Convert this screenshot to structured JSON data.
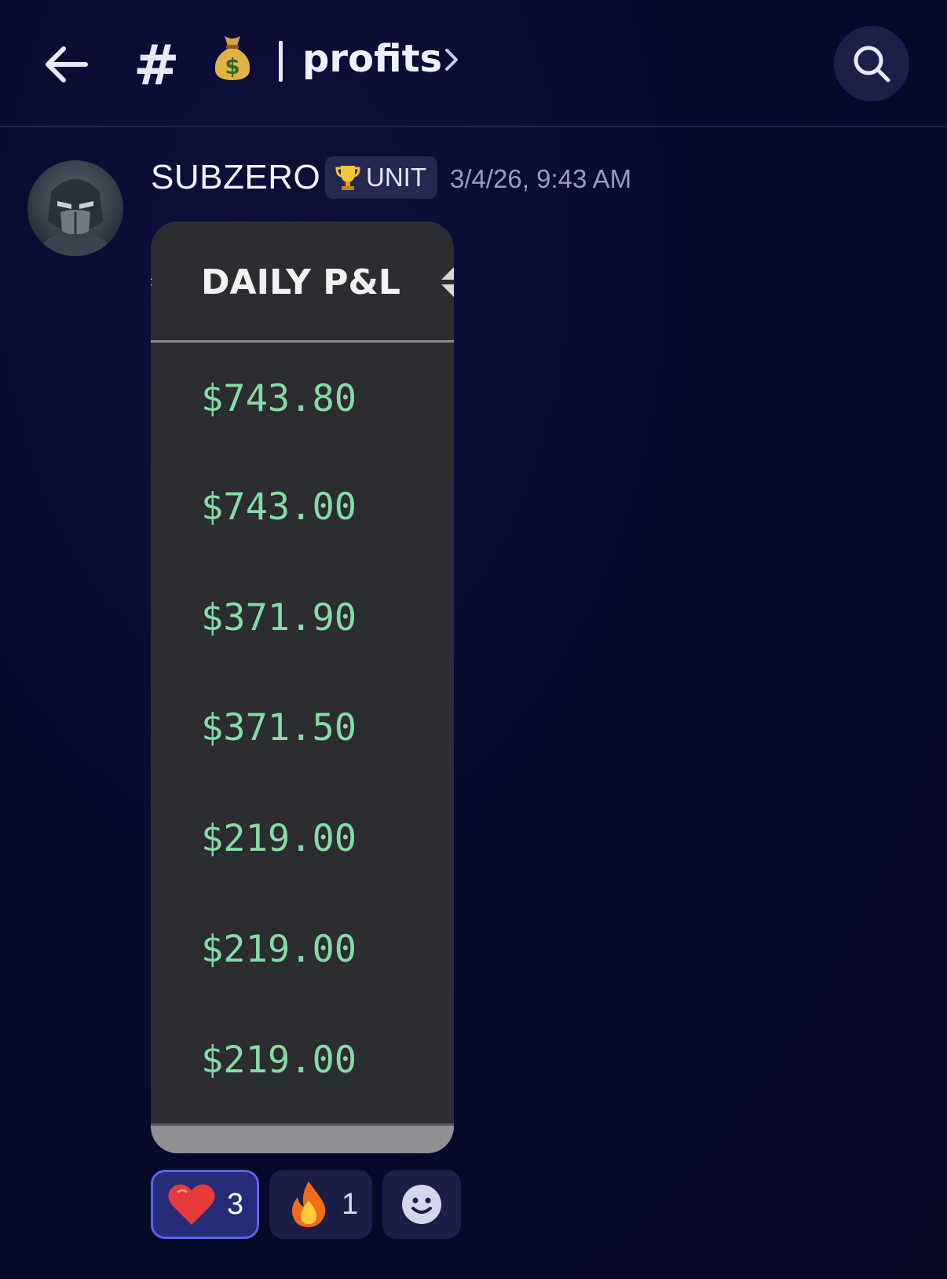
{
  "header": {
    "back_icon": "arrow-left-icon",
    "channel_prefix_icon": "hash-icon",
    "channel_prefix": "#",
    "channel_emoji_icon": "money-bag-icon",
    "channel_name": "profits",
    "chevron_icon": "chevron-right-icon",
    "search_icon": "search-icon"
  },
  "message": {
    "author": "SUBZERO",
    "role_icon": "trophy-icon",
    "role_label": "UNIT",
    "timestamp": "3/4/26, 9:43 AM",
    "attachment": {
      "column_title": "DAILY P&L",
      "rows": [
        "$743.80",
        "$743.00",
        "$371.90",
        "$371.50",
        "$219.00",
        "$219.00",
        "$219.00"
      ]
    }
  },
  "reactions": [
    {
      "icon": "heart-icon",
      "count": "3",
      "active": true
    },
    {
      "icon": "fire-icon",
      "count": "1",
      "active": false
    },
    {
      "icon": "add-reaction-icon",
      "count": "",
      "active": false
    }
  ],
  "colors": {
    "background": "#080a2c",
    "accent": "#5b63e6",
    "profit_green": "#86dba8",
    "attachment_bg": "#2c2d30"
  }
}
